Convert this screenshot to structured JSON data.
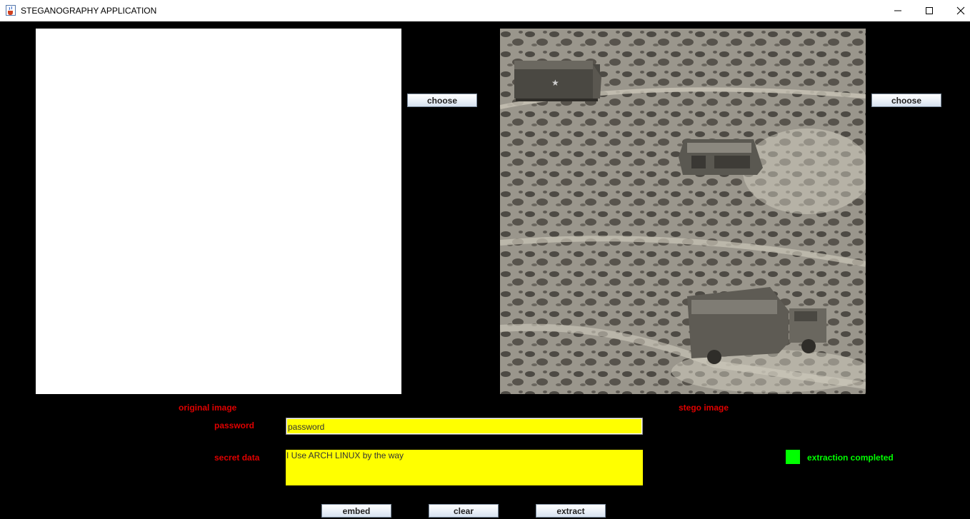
{
  "window": {
    "title": "STEGANOGRAPHY APPLICATION",
    "icon": "java-cup-icon"
  },
  "left_panel": {
    "choose_label": "choose",
    "caption": "original image"
  },
  "right_panel": {
    "choose_label": "choose",
    "caption": "stego image",
    "image_description_icon": "desert-vehicles-grayscale-photo"
  },
  "form": {
    "password_label": "password",
    "password_value": "password",
    "secret_label": "secret data",
    "secret_value": "I Use ARCH LINUX by the way"
  },
  "actions": {
    "embed_label": "embed",
    "clear_label": "clear",
    "extract_label": "extract"
  },
  "status": {
    "text": "extraction completed",
    "color": "#00ff00"
  },
  "colors": {
    "label_red": "#e00000",
    "field_yellow": "#ffff00",
    "background": "#000000"
  }
}
